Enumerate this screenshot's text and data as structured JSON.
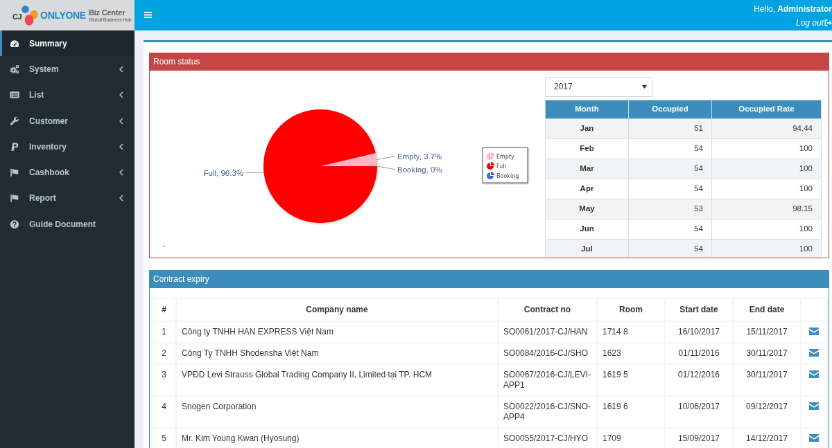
{
  "logo": {
    "mark": "CJ",
    "name": "ONLYONE",
    "suffix": "Biz Center",
    "tagline": "Global Business Hub"
  },
  "topbar": {
    "greeting": "Hello, **Administrator**",
    "logout": "Log out"
  },
  "sidebar": {
    "items": [
      {
        "label": "Summary",
        "selected": true,
        "has_submenu": false
      },
      {
        "label": "System",
        "selected": false,
        "has_submenu": true
      },
      {
        "label": "List",
        "selected": false,
        "has_submenu": true
      },
      {
        "label": "Customer",
        "selected": false,
        "has_submenu": true
      },
      {
        "label": "Inventory",
        "selected": false,
        "has_submenu": true
      },
      {
        "label": "Cashbook",
        "selected": false,
        "has_submenu": true
      },
      {
        "label": "Report",
        "selected": false,
        "has_submenu": true
      },
      {
        "label": "Guide Document",
        "selected": false,
        "has_submenu": false
      }
    ]
  },
  "room_status": {
    "title": "Room status",
    "chart_data": {
      "type": "pie",
      "categories": [
        "Empty",
        "Full",
        "Booking"
      ],
      "values": [
        3.7,
        96.3,
        0
      ],
      "colors": [
        "#ffb6c1",
        "#ff0000",
        "#4169e1"
      ],
      "value_labels": [
        "Empty, 3.7%",
        "Full, 96.3%",
        "Booking, 0%"
      ],
      "legend": "right"
    },
    "note": "-",
    "year_select": {
      "value": "2017"
    },
    "table": {
      "columns": [
        "Month",
        "Occupied",
        "Occupied Rate"
      ],
      "rows": [
        [
          "Jan",
          "51",
          "94.44"
        ],
        [
          "Feb",
          "54",
          "100"
        ],
        [
          "Mar",
          "54",
          "100"
        ],
        [
          "Apr",
          "54",
          "100"
        ],
        [
          "May",
          "53",
          "98.15"
        ],
        [
          "Jun",
          "54",
          "100"
        ],
        [
          "Jul",
          "54",
          "100"
        ]
      ]
    }
  },
  "contract_expiry": {
    "title": "Contract expiry",
    "table": {
      "columns": [
        "#",
        "Company name",
        "Contract no",
        "Room",
        "Start date",
        "End date"
      ],
      "rows": [
        [
          "1",
          "Công ty TNHH HAN EXPRESS Việt Nam",
          "SO0061/2017-CJ/HAN",
          "1714 8",
          "16/10/2017",
          "15/11/2017"
        ],
        [
          "2",
          "Công Ty TNHH Shodensha Việt Nam",
          "SO0084/2016-CJ/SHO",
          "1623",
          "01/11/2016",
          "30/11/2017"
        ],
        [
          "3",
          "VPĐD Levi Strauss Global Trading Company II, Limited tại TP. HCM",
          "SO0067/2016-CJ/LEVI-APP1",
          "1619 5",
          "01/12/2016",
          "30/11/2017"
        ],
        [
          "4",
          "Snogen Corporation",
          "SO0022/2016-CJ/SNO-APP4",
          "1619 6",
          "10/06/2017",
          "09/12/2017"
        ],
        [
          "5",
          "Mr. Kim Young Kwan (Hyosung)",
          "SO0055/2017-CJ/HYO",
          "1709",
          "15/09/2017",
          "14/12/2017"
        ]
      ]
    }
  }
}
